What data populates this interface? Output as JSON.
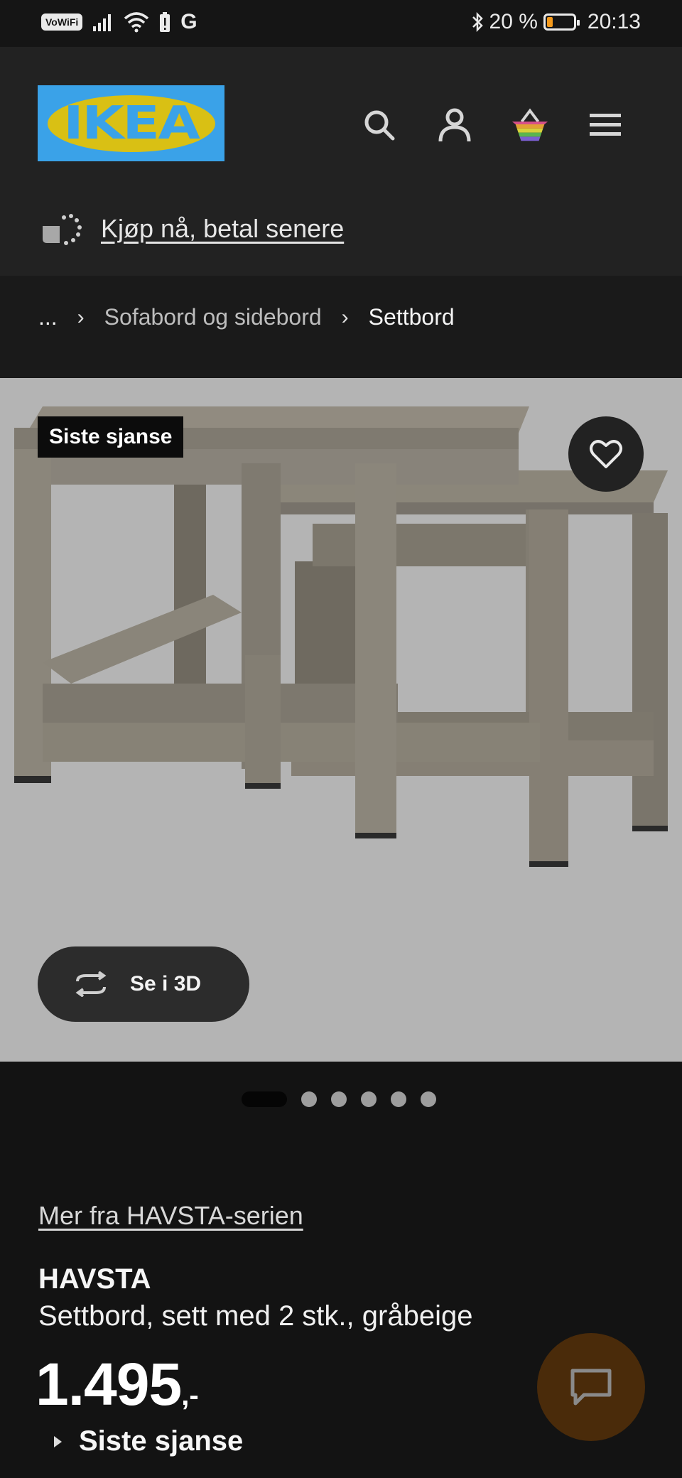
{
  "statusbar": {
    "vowifi": "VoWiFi",
    "g_label": "G",
    "battery_text": "20 %",
    "battery_level": 0.2,
    "time": "20:13"
  },
  "header": {
    "logo_text": "IKEA",
    "icons": [
      "search-icon",
      "user-icon",
      "basket-icon",
      "menu-icon"
    ],
    "bnpl_link": "Kjøp nå, betal senere"
  },
  "breadcrumb": {
    "ellipsis": "...",
    "items": [
      "Sofabord og sidebord",
      "Settbord"
    ]
  },
  "hero": {
    "badge": "Siste sjanse",
    "view3d_label": "Se i 3D",
    "carousel_total": 6,
    "carousel_active": 1
  },
  "product": {
    "series_link": "Mer fra HAVSTA-serien",
    "name": "HAVSTA",
    "description": "Settbord, sett med 2 stk., gråbeige",
    "price": "1.495",
    "price_suffix": ",-",
    "status": "Siste sjanse"
  },
  "colors": {
    "header_bg": "#222222",
    "hero_bg": "#b4b4b4",
    "logo_blue": "#3aa2e8",
    "logo_yellow": "#d9c014",
    "chat_bg": "#4a2b0a"
  }
}
